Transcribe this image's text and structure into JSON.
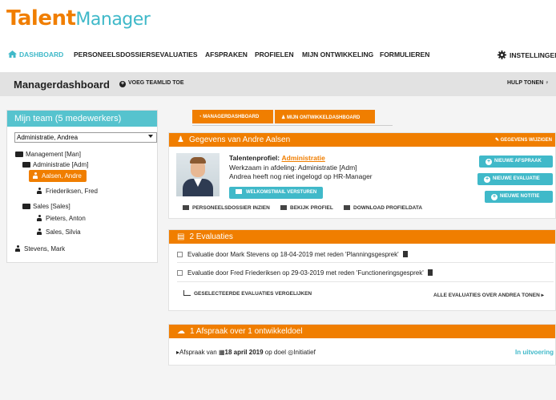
{
  "app": {
    "logo_main": "Talent",
    "logo_suffix": "Manager"
  },
  "nav": {
    "items": [
      "DASHBOARD",
      "PERSONEELSDOSSIERS",
      "EVALUATIES",
      "AFSPRAKEN",
      "PROFIELEN",
      "MIJN ONTWIKKELING",
      "FORMULIEREN"
    ],
    "settings": "INSTELLINGEN"
  },
  "subbar": {
    "title": "Managerdashboard",
    "add_button": "VOEG TEAMLID TOE",
    "help": "HULP TONEN"
  },
  "team": {
    "title": "Mijn team (5 medewerkers)",
    "selected": "Administratie, Andrea",
    "tree": [
      {
        "type": "folder",
        "label": "Management [Man]"
      },
      {
        "type": "folder",
        "label": "Administratie [Adm]"
      },
      {
        "type": "person",
        "label": "Aalsen, Andre",
        "selected": true
      },
      {
        "type": "person",
        "label": "Friederiksen, Fred"
      },
      {
        "type": "folder",
        "label": "Sales [Sales]"
      },
      {
        "type": "person",
        "label": "Pieters, Anton"
      },
      {
        "type": "person",
        "label": "Sales, Silvia"
      },
      {
        "type": "person",
        "label": "Stevens, Mark"
      }
    ]
  },
  "tabs": [
    "MANAGERDASHBOARD",
    "MIJN ONTWIKKELDASHBOARD"
  ],
  "profile": {
    "header": "Gegevens van Andre Aalsen",
    "edit": "GEGEVENS WIJZIGEN",
    "label": "Talentenprofiel:",
    "profile_link": "Administratie",
    "line1": "Werkzaam in afdeling: Administratie [Adm]",
    "line2": "Andrea heeft nog niet ingelogd op HR-Manager",
    "welcome_button": "WELKOMSTMAIL VERSTUREN",
    "actions": [
      "NIEUWE AFSPRAAK",
      "NIEUWE EVALUATIE",
      "NIEUWE NOTITIE"
    ],
    "links": [
      "PERSONEELSDOSSIER INZIEN",
      "BEKIJK PROFIEL",
      "DOWNLOAD PROFIELDATA"
    ]
  },
  "evaluations": {
    "header": "2 Evaluaties",
    "rows": [
      "Evaluatie door Mark Stevens op 18-04-2019 met reden 'Planningsgesprek'",
      "Evaluatie door Fred Friederiksen op 29-03-2019 met reden 'Functioneringsgesprek'"
    ],
    "compare": "GESELECTEERDE EVALUATIES VERGELIJKEN",
    "all": "ALLE EVALUATIES OVER ANDREA TONEN"
  },
  "appointments": {
    "header": "1 Afspraak over 1 ontwikkeldoel",
    "prefix": "Afspraak van",
    "date": "18 april 2019",
    "mid": "op doel",
    "goal": "Initiatief",
    "status": "In uitvoering"
  }
}
